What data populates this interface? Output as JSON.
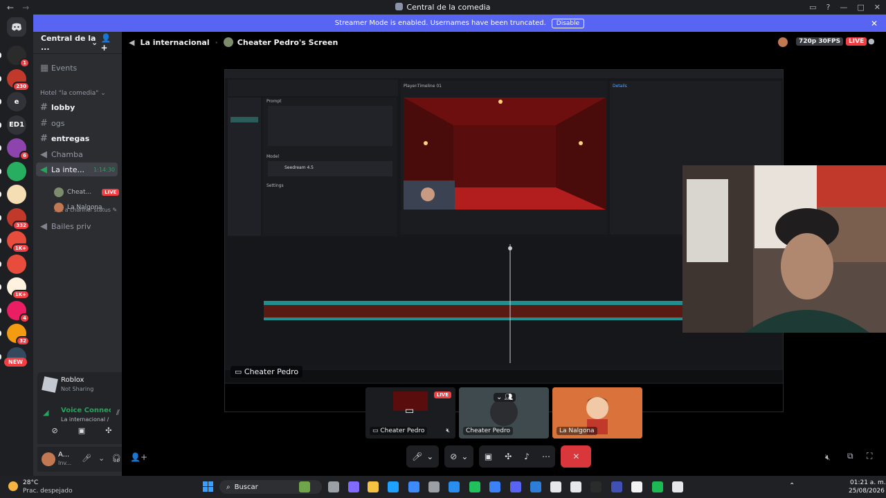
{
  "window": {
    "title": "Central de la comedia"
  },
  "streamer_bar": {
    "message": "Streamer Mode is enabled. Usernames have been truncated.",
    "disable_label": "Disable"
  },
  "servers": [
    {
      "label": "",
      "badge": "1",
      "color": "#2b2b2b"
    },
    {
      "label": "",
      "badge": "230",
      "color": "#c0392b"
    },
    {
      "label": "e",
      "badge": "",
      "color": "#313338"
    },
    {
      "label": "ED1",
      "badge": "",
      "color": "#313338"
    },
    {
      "label": "",
      "badge": "6",
      "color": "#8e44ad"
    },
    {
      "label": "",
      "badge": "",
      "color": "#27ae60"
    },
    {
      "label": "",
      "badge": "",
      "color": "#f5deb3"
    },
    {
      "label": "",
      "badge": "332",
      "color": "#c0392b"
    },
    {
      "label": "",
      "badge": "1K+",
      "color": "#e74c3c"
    },
    {
      "label": "",
      "badge": "",
      "color": "#e74c3c"
    },
    {
      "label": "",
      "badge": "1K+",
      "color": "#fff3e0"
    },
    {
      "label": "",
      "badge": "4",
      "color": "#e91e63"
    },
    {
      "label": "",
      "badge": "32",
      "color": "#f39c12"
    },
    {
      "label": "",
      "badge": "",
      "color": "#34495e"
    }
  ],
  "new_label": "NEW",
  "guild": {
    "name": "Central de la ..."
  },
  "channels": {
    "events": "Events",
    "category": "Hotel \"la comedia\"",
    "lobby": "lobby",
    "ogs": "ogs",
    "entregas": "entregas",
    "chamba": "Chamba",
    "voice_active": "La inte...",
    "voice_timer": "1:14:30",
    "status_hint": "Set a channel status",
    "user1": "Cheat...",
    "user1_live": "LIVE",
    "user2": "La Nalgona",
    "bailes": "Bailes priv"
  },
  "activity": {
    "game": "Roblox",
    "status": "Not Sharing"
  },
  "voice": {
    "status": "Voice Connected",
    "channel": "La internacional / ..."
  },
  "user": {
    "name": "A...",
    "sub": "Inv..."
  },
  "stage": {
    "channel": "La internacional",
    "stream_title": "Cheater Pedro's Screen",
    "quality": "720p 30FPS",
    "live": "LIVE",
    "stream_owner": "Cheater Pedro"
  },
  "tiles": [
    {
      "name": "Cheater Pedro",
      "live": "LIVE"
    },
    {
      "name": "Cheater Pedro"
    },
    {
      "name": "La Nalgona"
    }
  ],
  "taskbar": {
    "temp": "28°C",
    "weather": "Prac. despejado",
    "search": "Buscar",
    "time": "01:21 a. m.",
    "date": "25/08/2026"
  },
  "editor": {
    "details_title": "Details",
    "player_title": "Player-Timeline 01",
    "prompt_label": "Prompt",
    "model_label": "Model",
    "model_name": "Seedream 4.5",
    "settings_label": "Settings"
  },
  "colors": {
    "accent": "#5865f2",
    "live": "#f23f43",
    "green": "#23a55a"
  }
}
